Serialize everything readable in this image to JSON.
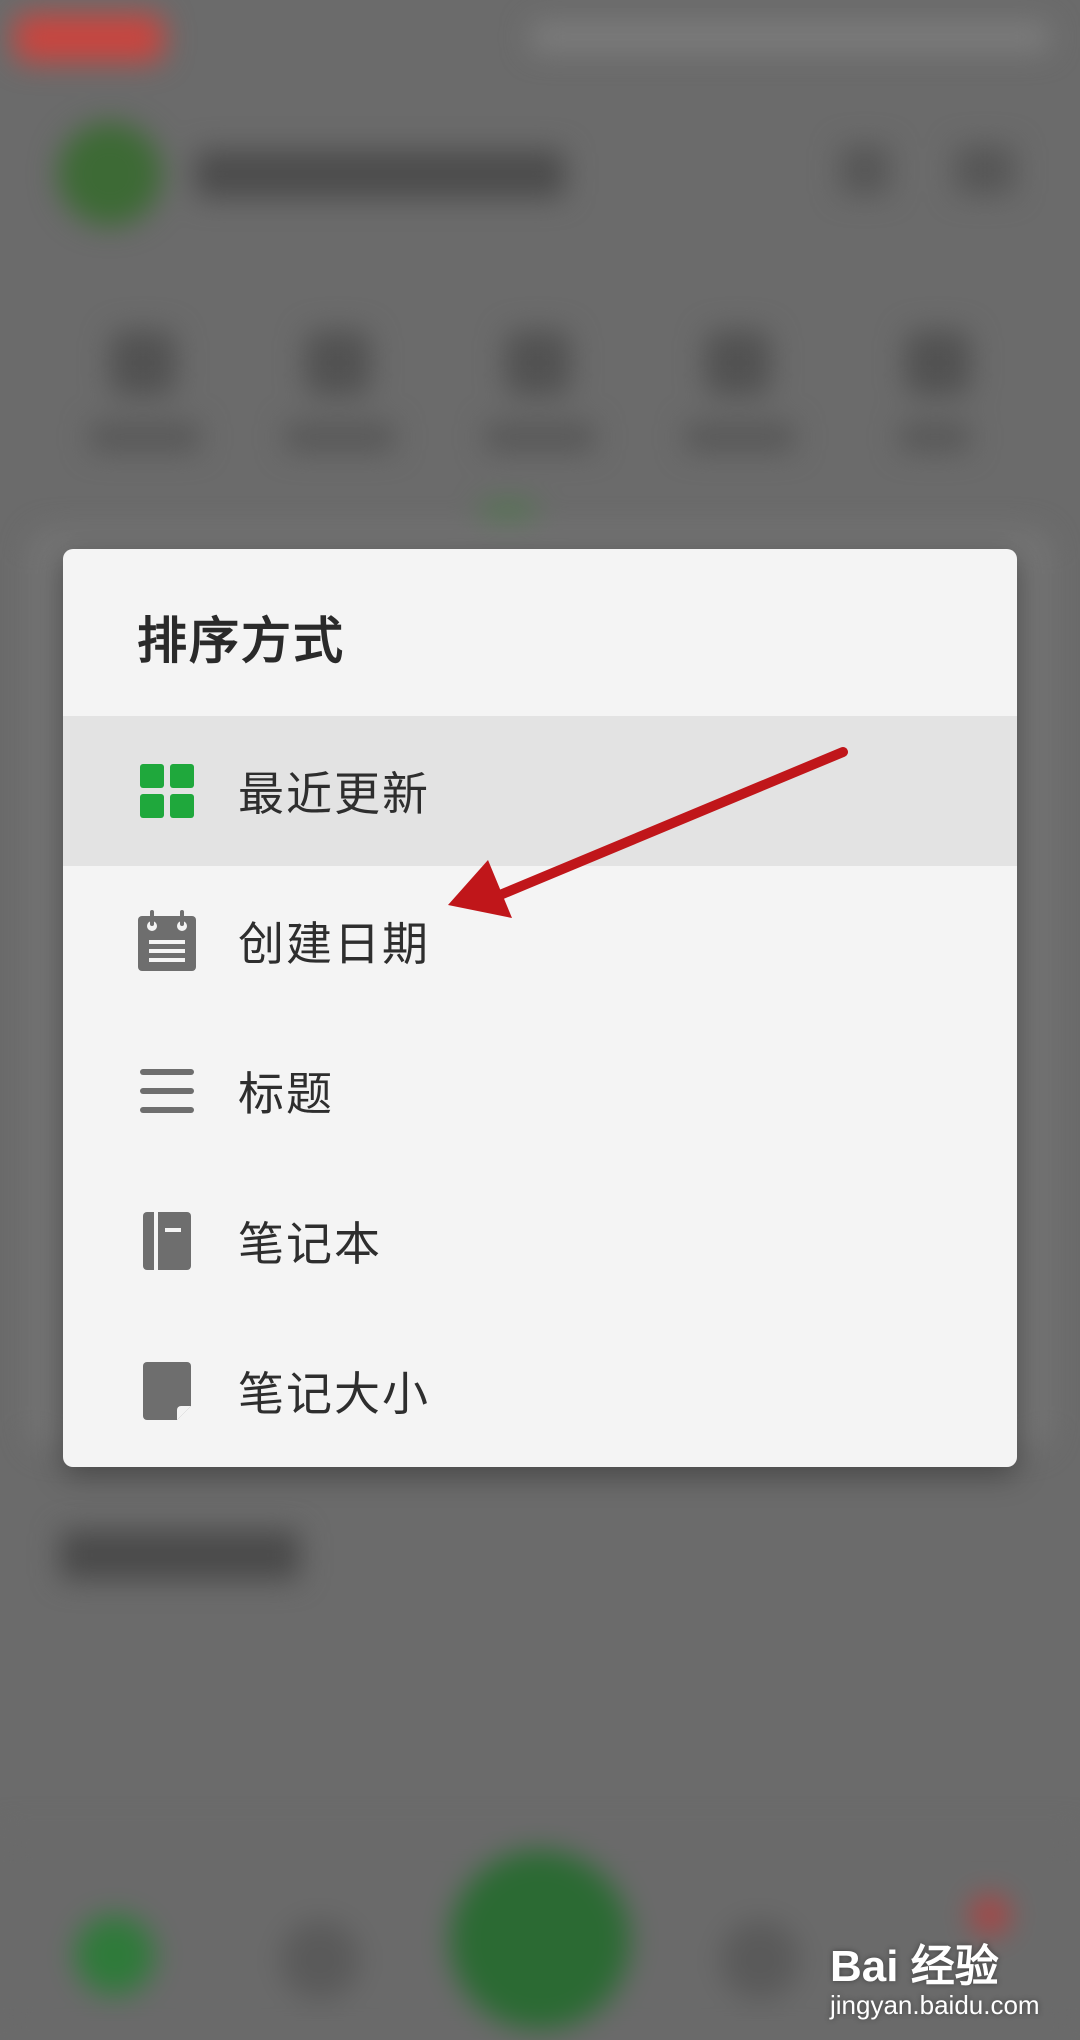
{
  "dialog": {
    "title": "排序方式",
    "options": [
      {
        "label": "最近更新",
        "icon": "grid-icon",
        "selected": true,
        "icon_color": "#1fa83c"
      },
      {
        "label": "创建日期",
        "icon": "calendar-icon",
        "selected": false,
        "icon_color": "#6e6e6e"
      },
      {
        "label": "标题",
        "icon": "menu-lines-icon",
        "selected": false,
        "icon_color": "#6e6e6e"
      },
      {
        "label": "笔记本",
        "icon": "notebook-icon",
        "selected": false,
        "icon_color": "#6e6e6e"
      },
      {
        "label": "笔记大小",
        "icon": "note-page-icon",
        "selected": false,
        "icon_color": "#6e6e6e"
      }
    ]
  },
  "annotation": {
    "arrow_color": "#c0161a"
  },
  "watermark": {
    "brand": "Bai 经验",
    "url": "jingyan.baidu.com"
  },
  "colors": {
    "accent": "#1fa83c",
    "selected_bg": "#e3e3e3",
    "dialog_bg": "#f4f4f4"
  }
}
